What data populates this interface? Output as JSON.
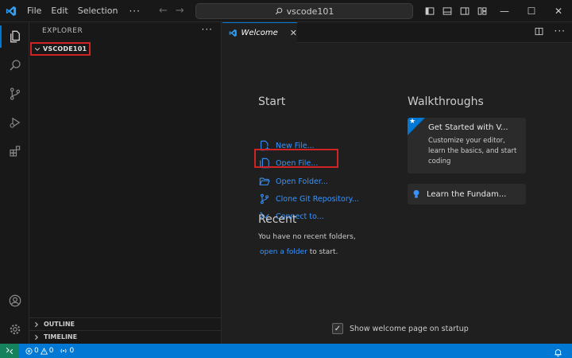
{
  "titlebar": {
    "menu": [
      "File",
      "Edit",
      "Selection"
    ],
    "more": "···",
    "search_text": "vscode101",
    "window_controls": {
      "minimize": "—",
      "maximize": "☐",
      "close": "✕"
    }
  },
  "activitybar": {
    "items": [
      "explorer-icon",
      "search-icon",
      "source-control-icon",
      "run-debug-icon",
      "extensions-icon"
    ],
    "bottom": [
      "accounts-icon",
      "manage-gear-icon"
    ]
  },
  "sidebar": {
    "header": "EXPLORER",
    "more": "···",
    "folder": "VSCODE101",
    "outline": "OUTLINE",
    "timeline": "TIMELINE"
  },
  "tab": {
    "label": "Welcome",
    "close": "✕"
  },
  "welcome": {
    "start_title": "Start",
    "start_items": [
      {
        "label": "New File...",
        "icon": "new-file-icon"
      },
      {
        "label": "Open File...",
        "icon": "open-file-icon"
      },
      {
        "label": "Open Folder...",
        "icon": "open-folder-icon"
      },
      {
        "label": "Clone Git Repository...",
        "icon": "git-clone-icon"
      },
      {
        "label": "Connect to...",
        "icon": "remote-connect-icon"
      }
    ],
    "recent_title": "Recent",
    "recent_empty": "You have no recent folders,",
    "recent_link": "open a folder",
    "recent_suffix": " to start.",
    "walkthroughs_title": "Walkthroughs",
    "walk1_title": "Get Started with V...",
    "walk1_desc": "Customize your editor, learn the basics, and start coding",
    "walk2_title": "Learn the Fundam...",
    "startup_label": "Show welcome page on startup",
    "startup_checked": "✓"
  },
  "statusbar": {
    "errors": "0",
    "warnings": "0",
    "ports": "0"
  },
  "colors": {
    "accent": "#0078d4",
    "link": "#3794ff",
    "annotation": "#d02424",
    "remote": "#16825d"
  }
}
